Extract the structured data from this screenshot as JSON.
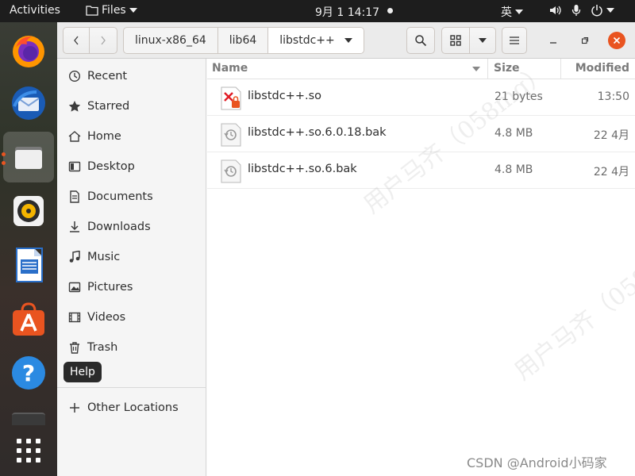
{
  "topbar": {
    "activities": "Activities",
    "app_name": "Files",
    "clock": "9月 1  14:17",
    "input_method": "英"
  },
  "tooltip": "Help",
  "breadcrumbs": [
    "linux-x86_64",
    "lib64",
    "libstdc++"
  ],
  "sidebar": {
    "items": [
      {
        "label": "Recent",
        "icon": "recent-icon"
      },
      {
        "label": "Starred",
        "icon": "star-icon"
      },
      {
        "label": "Home",
        "icon": "home-icon"
      },
      {
        "label": "Desktop",
        "icon": "desktop-icon"
      },
      {
        "label": "Documents",
        "icon": "documents-icon"
      },
      {
        "label": "Downloads",
        "icon": "downloads-icon"
      },
      {
        "label": "Music",
        "icon": "music-icon"
      },
      {
        "label": "Pictures",
        "icon": "pictures-icon"
      },
      {
        "label": "Videos",
        "icon": "videos-icon"
      },
      {
        "label": "Trash",
        "icon": "trash-icon"
      }
    ],
    "other_locations": "Other Locations"
  },
  "list": {
    "columns": {
      "name": "Name",
      "size": "Size",
      "modified": "Modified"
    },
    "rows": [
      {
        "name": "libstdc++.so",
        "size": "21 bytes",
        "modified": "13:50",
        "icon": "broken-link-icon"
      },
      {
        "name": "libstdc++.so.6.0.18.bak",
        "size": "4.8 MB",
        "modified": "22 4月",
        "icon": "backup-file-icon"
      },
      {
        "name": "libstdc++.so.6.bak",
        "size": "4.8 MB",
        "modified": "22 4月",
        "icon": "backup-file-icon"
      }
    ]
  },
  "watermark_text": "用户马齐（058mq）",
  "footer_mark": "CSDN @Android小码家",
  "colors": {
    "accent": "#e95420",
    "topbar": "#1d1d1d",
    "sidebar": "#f5f5f5"
  }
}
